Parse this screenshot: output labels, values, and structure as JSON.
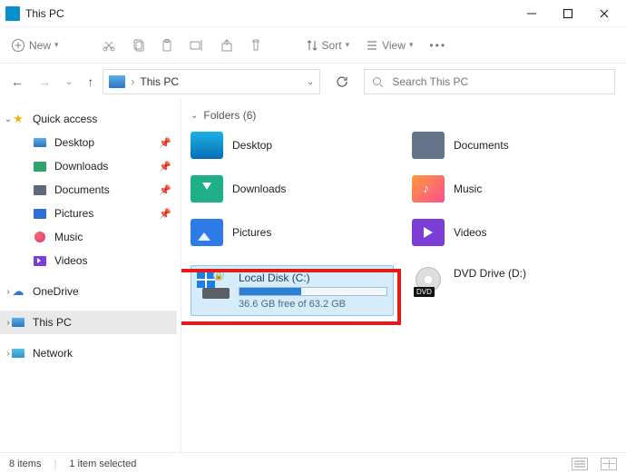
{
  "window": {
    "title": "This PC"
  },
  "toolbar": {
    "new_label": "New",
    "sort_label": "Sort",
    "view_label": "View"
  },
  "nav": {
    "location": "This PC",
    "search_placeholder": "Search This PC"
  },
  "sidebar": {
    "quick_access": "Quick access",
    "items": [
      {
        "label": "Desktop"
      },
      {
        "label": "Downloads"
      },
      {
        "label": "Documents"
      },
      {
        "label": "Pictures"
      },
      {
        "label": "Music"
      },
      {
        "label": "Videos"
      }
    ],
    "onedrive": "OneDrive",
    "this_pc": "This PC",
    "network": "Network"
  },
  "content": {
    "folders_header": "Folders (6)",
    "folders": [
      {
        "label": "Desktop"
      },
      {
        "label": "Documents"
      },
      {
        "label": "Downloads"
      },
      {
        "label": "Music"
      },
      {
        "label": "Pictures"
      },
      {
        "label": "Videos"
      }
    ],
    "drive": {
      "name": "Local Disk (C:)",
      "free_text": "36.6 GB free of 63.2 GB",
      "fill_percent": 42
    },
    "dvd": {
      "label": "DVD Drive (D:)",
      "tag": "DVD"
    }
  },
  "status": {
    "items": "8 items",
    "selected": "1 item selected"
  }
}
